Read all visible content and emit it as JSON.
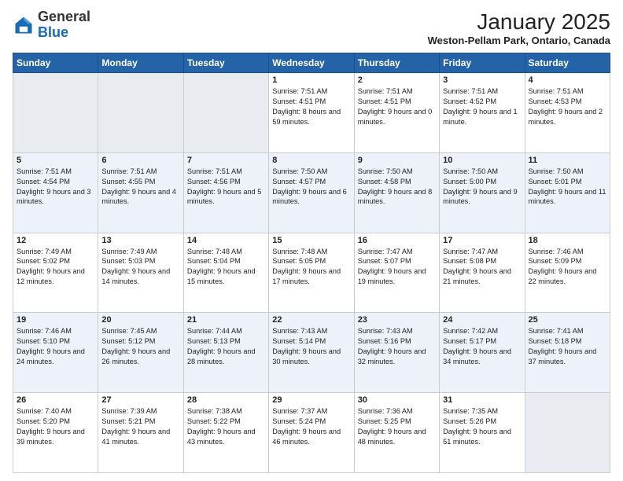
{
  "header": {
    "logo_general": "General",
    "logo_blue": "Blue",
    "month_title": "January 2025",
    "location": "Weston-Pellam Park, Ontario, Canada"
  },
  "days_of_week": [
    "Sunday",
    "Monday",
    "Tuesday",
    "Wednesday",
    "Thursday",
    "Friday",
    "Saturday"
  ],
  "weeks": [
    [
      {
        "day": "",
        "info": ""
      },
      {
        "day": "",
        "info": ""
      },
      {
        "day": "",
        "info": ""
      },
      {
        "day": "1",
        "info": "Sunrise: 7:51 AM\nSunset: 4:51 PM\nDaylight: 8 hours and 59 minutes."
      },
      {
        "day": "2",
        "info": "Sunrise: 7:51 AM\nSunset: 4:51 PM\nDaylight: 9 hours and 0 minutes."
      },
      {
        "day": "3",
        "info": "Sunrise: 7:51 AM\nSunset: 4:52 PM\nDaylight: 9 hours and 1 minute."
      },
      {
        "day": "4",
        "info": "Sunrise: 7:51 AM\nSunset: 4:53 PM\nDaylight: 9 hours and 2 minutes."
      }
    ],
    [
      {
        "day": "5",
        "info": "Sunrise: 7:51 AM\nSunset: 4:54 PM\nDaylight: 9 hours and 3 minutes."
      },
      {
        "day": "6",
        "info": "Sunrise: 7:51 AM\nSunset: 4:55 PM\nDaylight: 9 hours and 4 minutes."
      },
      {
        "day": "7",
        "info": "Sunrise: 7:51 AM\nSunset: 4:56 PM\nDaylight: 9 hours and 5 minutes."
      },
      {
        "day": "8",
        "info": "Sunrise: 7:50 AM\nSunset: 4:57 PM\nDaylight: 9 hours and 6 minutes."
      },
      {
        "day": "9",
        "info": "Sunrise: 7:50 AM\nSunset: 4:58 PM\nDaylight: 9 hours and 8 minutes."
      },
      {
        "day": "10",
        "info": "Sunrise: 7:50 AM\nSunset: 5:00 PM\nDaylight: 9 hours and 9 minutes."
      },
      {
        "day": "11",
        "info": "Sunrise: 7:50 AM\nSunset: 5:01 PM\nDaylight: 9 hours and 11 minutes."
      }
    ],
    [
      {
        "day": "12",
        "info": "Sunrise: 7:49 AM\nSunset: 5:02 PM\nDaylight: 9 hours and 12 minutes."
      },
      {
        "day": "13",
        "info": "Sunrise: 7:49 AM\nSunset: 5:03 PM\nDaylight: 9 hours and 14 minutes."
      },
      {
        "day": "14",
        "info": "Sunrise: 7:48 AM\nSunset: 5:04 PM\nDaylight: 9 hours and 15 minutes."
      },
      {
        "day": "15",
        "info": "Sunrise: 7:48 AM\nSunset: 5:05 PM\nDaylight: 9 hours and 17 minutes."
      },
      {
        "day": "16",
        "info": "Sunrise: 7:47 AM\nSunset: 5:07 PM\nDaylight: 9 hours and 19 minutes."
      },
      {
        "day": "17",
        "info": "Sunrise: 7:47 AM\nSunset: 5:08 PM\nDaylight: 9 hours and 21 minutes."
      },
      {
        "day": "18",
        "info": "Sunrise: 7:46 AM\nSunset: 5:09 PM\nDaylight: 9 hours and 22 minutes."
      }
    ],
    [
      {
        "day": "19",
        "info": "Sunrise: 7:46 AM\nSunset: 5:10 PM\nDaylight: 9 hours and 24 minutes."
      },
      {
        "day": "20",
        "info": "Sunrise: 7:45 AM\nSunset: 5:12 PM\nDaylight: 9 hours and 26 minutes."
      },
      {
        "day": "21",
        "info": "Sunrise: 7:44 AM\nSunset: 5:13 PM\nDaylight: 9 hours and 28 minutes."
      },
      {
        "day": "22",
        "info": "Sunrise: 7:43 AM\nSunset: 5:14 PM\nDaylight: 9 hours and 30 minutes."
      },
      {
        "day": "23",
        "info": "Sunrise: 7:43 AM\nSunset: 5:16 PM\nDaylight: 9 hours and 32 minutes."
      },
      {
        "day": "24",
        "info": "Sunrise: 7:42 AM\nSunset: 5:17 PM\nDaylight: 9 hours and 34 minutes."
      },
      {
        "day": "25",
        "info": "Sunrise: 7:41 AM\nSunset: 5:18 PM\nDaylight: 9 hours and 37 minutes."
      }
    ],
    [
      {
        "day": "26",
        "info": "Sunrise: 7:40 AM\nSunset: 5:20 PM\nDaylight: 9 hours and 39 minutes."
      },
      {
        "day": "27",
        "info": "Sunrise: 7:39 AM\nSunset: 5:21 PM\nDaylight: 9 hours and 41 minutes."
      },
      {
        "day": "28",
        "info": "Sunrise: 7:38 AM\nSunset: 5:22 PM\nDaylight: 9 hours and 43 minutes."
      },
      {
        "day": "29",
        "info": "Sunrise: 7:37 AM\nSunset: 5:24 PM\nDaylight: 9 hours and 46 minutes."
      },
      {
        "day": "30",
        "info": "Sunrise: 7:36 AM\nSunset: 5:25 PM\nDaylight: 9 hours and 48 minutes."
      },
      {
        "day": "31",
        "info": "Sunrise: 7:35 AM\nSunset: 5:26 PM\nDaylight: 9 hours and 51 minutes."
      },
      {
        "day": "",
        "info": ""
      }
    ]
  ]
}
